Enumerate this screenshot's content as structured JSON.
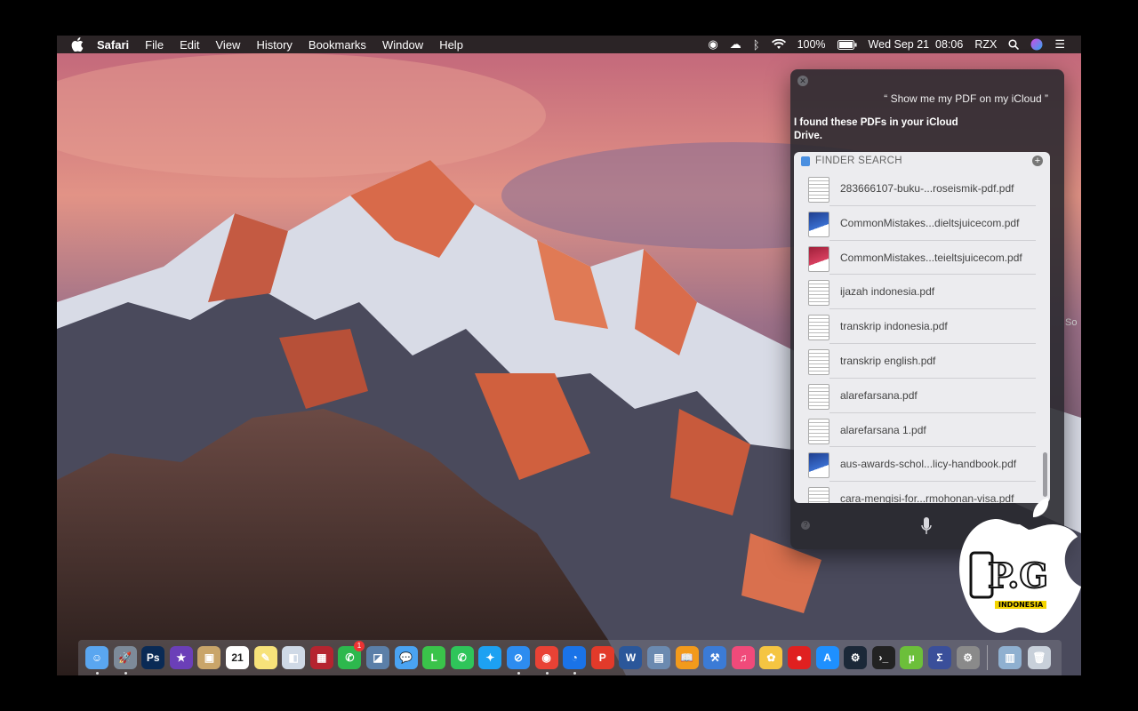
{
  "menubar": {
    "app_name": "Safari",
    "menus": [
      "File",
      "Edit",
      "View",
      "History",
      "Bookmarks",
      "Window",
      "Help"
    ],
    "battery_percent": "100%",
    "datetime": "Wed Sep 21  08:06",
    "user": "RZX"
  },
  "siri": {
    "query": "“ Show me my PDF on my iCloud ”",
    "answer": "I found these PDFs in your iCloud Drive.",
    "card_title": "FINDER SEARCH",
    "files": [
      {
        "name": "283666107-buku-...roseismik-pdf.pdf",
        "icon": "pdf-doc-icon"
      },
      {
        "name": "CommonMistakes...dieltsjuicecom.pdf",
        "icon": "pdf-cover-blue-icon"
      },
      {
        "name": "CommonMistakes...teieltsjuicecom.pdf",
        "icon": "pdf-cover-red-icon"
      },
      {
        "name": "ijazah indonesia.pdf",
        "icon": "pdf-doc-icon"
      },
      {
        "name": "transkrip indonesia.pdf",
        "icon": "pdf-doc-icon"
      },
      {
        "name": "transkrip english.pdf",
        "icon": "pdf-doc-icon"
      },
      {
        "name": "alarefarsana.pdf",
        "icon": "pdf-doc-icon"
      },
      {
        "name": "alarefarsana 1.pdf",
        "icon": "pdf-doc-icon"
      },
      {
        "name": "aus-awards-schol...licy-handbook.pdf",
        "icon": "pdf-cover-blue-icon"
      },
      {
        "name": "cara-mengisi-for...rmohonan-visa.pdf",
        "icon": "pdf-doc-icon"
      }
    ]
  },
  "dock": {
    "calendar_day": "21",
    "messages_badge": "1",
    "apps": [
      "Finder",
      "Launchpad",
      "Photoshop",
      "iMovie",
      "Contacts",
      "Calendar",
      "Notes",
      "Preview",
      "Photo Booth",
      "FaceTime",
      "Image Capture",
      "Messages",
      "LINE",
      "WhatsApp",
      "Twitter",
      "Safari",
      "Chrome",
      "Edge",
      "WPS",
      "Word",
      "Photos Library",
      "iBooks",
      "Xcode",
      "iTunes",
      "Photos",
      "Music Player",
      "App Store",
      "Steam",
      "Terminal",
      "uTorrent",
      "Sigma",
      "System Preferences",
      "Downloads",
      "Trash"
    ]
  },
  "watermark": {
    "text": "P.G",
    "tag": "INDONESIA"
  },
  "side_text": "So"
}
